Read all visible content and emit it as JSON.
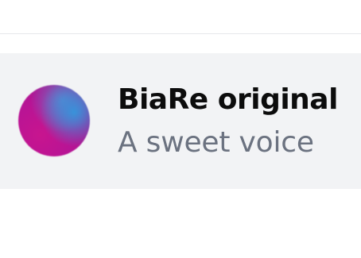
{
  "voice_card": {
    "name": "BiaRe original",
    "description": "A sweet voice",
    "avatar_colors": [
      "#c8158f",
      "#3496dc"
    ]
  }
}
